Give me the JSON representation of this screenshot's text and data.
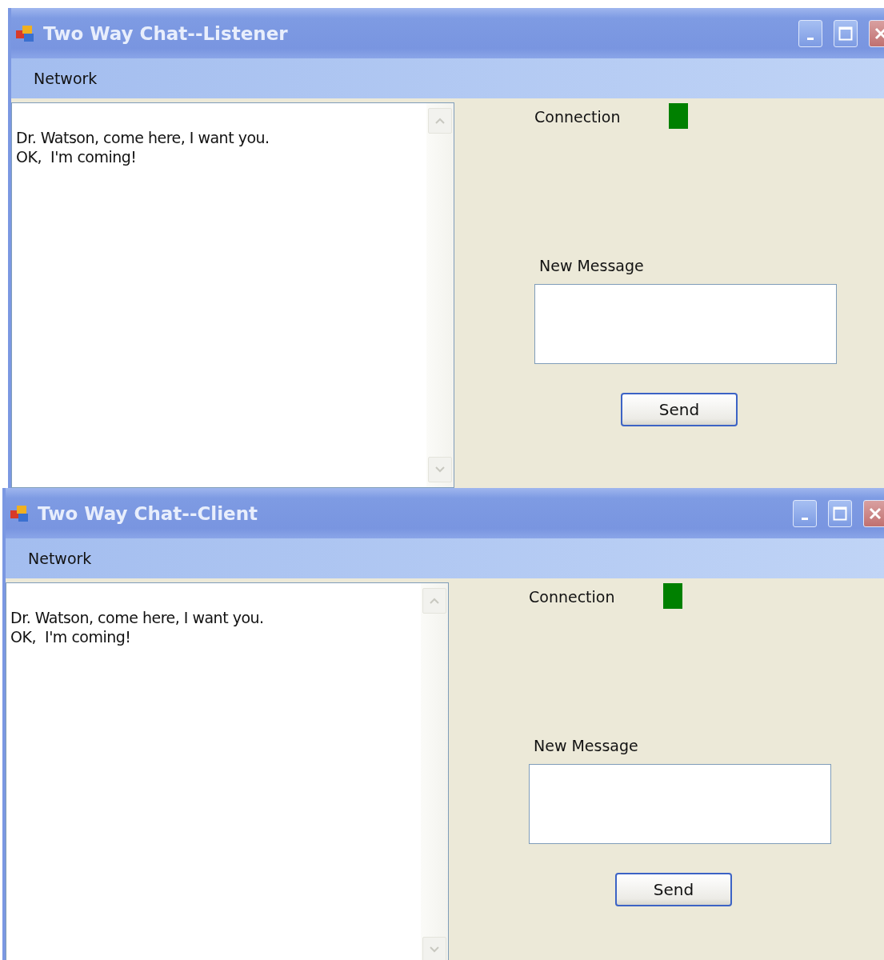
{
  "windows": [
    {
      "title": "Two Way Chat--Listener",
      "menu": [
        "Network"
      ],
      "messages": [
        "Dr. Watson, come here, I want you.",
        "OK,  I'm coming!"
      ],
      "connection": {
        "label": "Connection",
        "connected": true
      },
      "new_message_label": "New Message",
      "send_button": "Send"
    },
    {
      "title": "Two Way Chat--Client",
      "menu": [
        "Network"
      ],
      "messages": [
        "Dr. Watson, come here, I want you.",
        "OK,  I'm coming!"
      ],
      "connection": {
        "label": "Connection",
        "connected": true
      },
      "new_message_label": "New Message",
      "send_button": "Send"
    }
  ]
}
